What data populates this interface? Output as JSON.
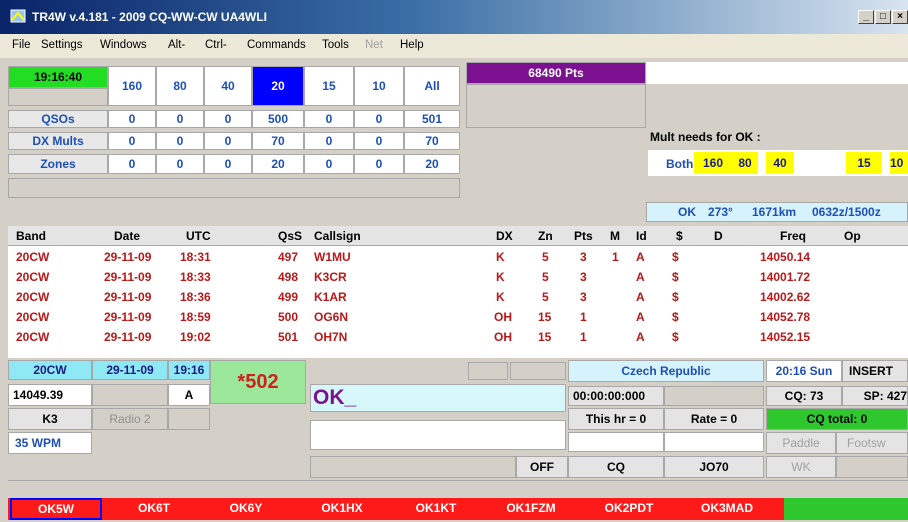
{
  "window": {
    "title": "TR4W v.4.181 - 2009 CQ-WW-CW UA4WLI",
    "min": "_",
    "max": "□",
    "close": "×"
  },
  "menu": [
    "File",
    "Settings",
    "Windows",
    "Alt-",
    "Ctrl-",
    "Commands",
    "Tools",
    "Net",
    "Help"
  ],
  "clock": "19:16:40",
  "bands": [
    "160",
    "80",
    "40",
    "20",
    "15",
    "10",
    "All"
  ],
  "stats": [
    {
      "label": "QSOs",
      "values": [
        "0",
        "0",
        "0",
        "500",
        "0",
        "0",
        "501"
      ]
    },
    {
      "label": "DX Mults",
      "values": [
        "0",
        "0",
        "0",
        "70",
        "0",
        "0",
        "70"
      ]
    },
    {
      "label": "Zones",
      "values": [
        "0",
        "0",
        "0",
        "20",
        "0",
        "0",
        "20"
      ]
    }
  ],
  "points": "68490 Pts",
  "mult_needs": {
    "title": "Mult needs for OK :",
    "both_label": "Both:",
    "bands": [
      "160",
      "80",
      "40",
      "15",
      "10"
    ]
  },
  "beam": {
    "prefix": "OK",
    "bearing": "273°",
    "distance": "1671km",
    "times": "0632z/1500z"
  },
  "log": {
    "headers": [
      "Band",
      "Date",
      "UTC",
      "QsS",
      "Callsign",
      "DX",
      "Zn",
      "Pts",
      "M",
      "Id",
      "$",
      "D",
      "Freq",
      "Op"
    ],
    "rows": [
      [
        "20CW",
        "29-11-09",
        "18:31",
        "497",
        "W1MU",
        "K",
        "5",
        "3",
        "1",
        "A",
        "$",
        "",
        "14050.14",
        ""
      ],
      [
        "20CW",
        "29-11-09",
        "18:33",
        "498",
        "K3CR",
        "K",
        "5",
        "3",
        "",
        "A",
        "$",
        "",
        "14001.72",
        ""
      ],
      [
        "20CW",
        "29-11-09",
        "18:36",
        "499",
        "K1AR",
        "K",
        "5",
        "3",
        "",
        "A",
        "$",
        "",
        "14002.62",
        ""
      ],
      [
        "20CW",
        "29-11-09",
        "18:59",
        "500",
        "OG6N",
        "OH",
        "15",
        "1",
        "",
        "A",
        "$",
        "",
        "14052.78",
        ""
      ],
      [
        "20CW",
        "29-11-09",
        "19:02",
        "501",
        "OH7N",
        "OH",
        "15",
        "1",
        "",
        "A",
        "$",
        "",
        "14052.15",
        ""
      ]
    ]
  },
  "entry": {
    "band": "20CW",
    "date": "29-11-09",
    "time": "19:16",
    "serial": "*502",
    "freq": "14049.39",
    "mode": "A",
    "radio1": "K3",
    "radio2": "Radio 2",
    "wpm": "35 WPM",
    "call": "OK_",
    "country": "Czech Republic",
    "local_time": "20:16 Sun",
    "insert": "INSERT",
    "timer": "00:00:00:000",
    "cq_count": "CQ: 73",
    "sp_count": "SP: 427",
    "this_hr": "This hr = 0",
    "rate": "Rate = 0",
    "cq_total": "CQ total: 0",
    "paddle": "Paddle",
    "footsw": "Footsw",
    "off": "OFF",
    "cq": "CQ",
    "grid": "JO70",
    "wk": "WK"
  },
  "callstack": [
    "OK5W",
    "OK6T",
    "OK6Y",
    "OK1HX",
    "OK1KT",
    "OK1FZM",
    "OK2PDT",
    "OK3MAD",
    ""
  ],
  "colors": {
    "accent": "#0000ff",
    "purple": "#7b1191",
    "callstack": "#ff1a1a",
    "green": "#2ec82e",
    "cyan": "#8fe9f5"
  }
}
